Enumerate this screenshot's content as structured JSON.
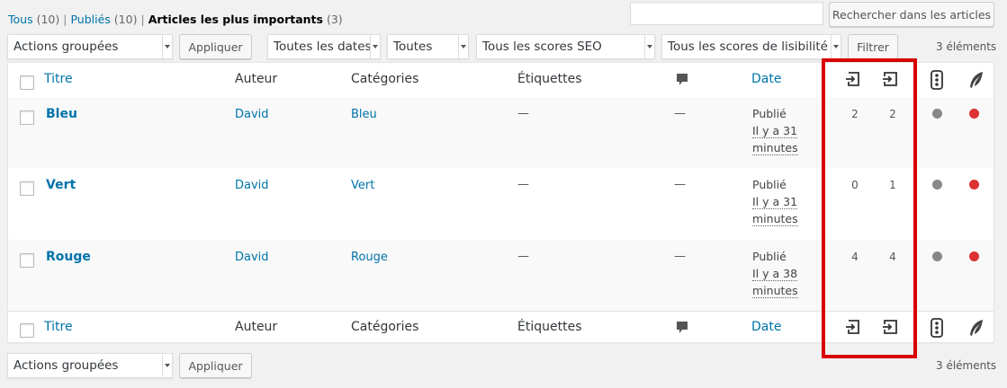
{
  "filters_nav": {
    "all_label": "Tous",
    "all_count": "(10)",
    "published_label": "Publiés",
    "published_count": "(10)",
    "cornerstone_label": "Articles les plus importants",
    "cornerstone_count": "(3)",
    "separator": "|"
  },
  "search": {
    "value": "",
    "button_label": "Rechercher dans les articles"
  },
  "top_toolbar": {
    "bulk_actions": "Actions groupées",
    "apply_label": "Appliquer",
    "dates_filter": "Toutes les dates",
    "categories_filter": "Toutes",
    "seo_filter": "Tous les scores SEO",
    "readability_filter": "Tous les scores de lisibilité",
    "filter_label": "Filtrer",
    "count": "3 éléments"
  },
  "columns": {
    "title": "Titre",
    "author": "Auteur",
    "categories": "Catégories",
    "tags": "Étiquettes",
    "date": "Date",
    "icons": [
      "comments-icon",
      "outgoing-links-icon",
      "incoming-links-icon",
      "seo-score-icon",
      "readability-icon"
    ]
  },
  "rows": [
    {
      "title": "Bleu",
      "author": "David",
      "category": "Bleu",
      "tags": "—",
      "comments": "—",
      "status": "Publié",
      "date_line1": "Il y a 31",
      "date_line2": "minutes",
      "links_out": "2",
      "links_in": "2",
      "seo_color": "#888888",
      "readability_color": "#dc3232"
    },
    {
      "title": "Vert",
      "author": "David",
      "category": "Vert",
      "tags": "—",
      "comments": "—",
      "status": "Publié",
      "date_line1": "Il y a 31",
      "date_line2": "minutes",
      "links_out": "0",
      "links_in": "1",
      "seo_color": "#888888",
      "readability_color": "#dc3232"
    },
    {
      "title": "Rouge",
      "author": "David",
      "category": "Rouge",
      "tags": "—",
      "comments": "—",
      "status": "Publié",
      "date_line1": "Il y a 38",
      "date_line2": "minutes",
      "links_out": "4",
      "links_in": "4",
      "seo_color": "#888888",
      "readability_color": "#dc3232"
    }
  ],
  "bottom_toolbar": {
    "bulk_actions": "Actions groupées",
    "apply_label": "Appliquer",
    "count": "3 éléments"
  },
  "colors": {
    "link": "#0073aa",
    "highlight": "#d80000",
    "seo_dot": "#888888",
    "readability_dot": "#dc3232"
  }
}
